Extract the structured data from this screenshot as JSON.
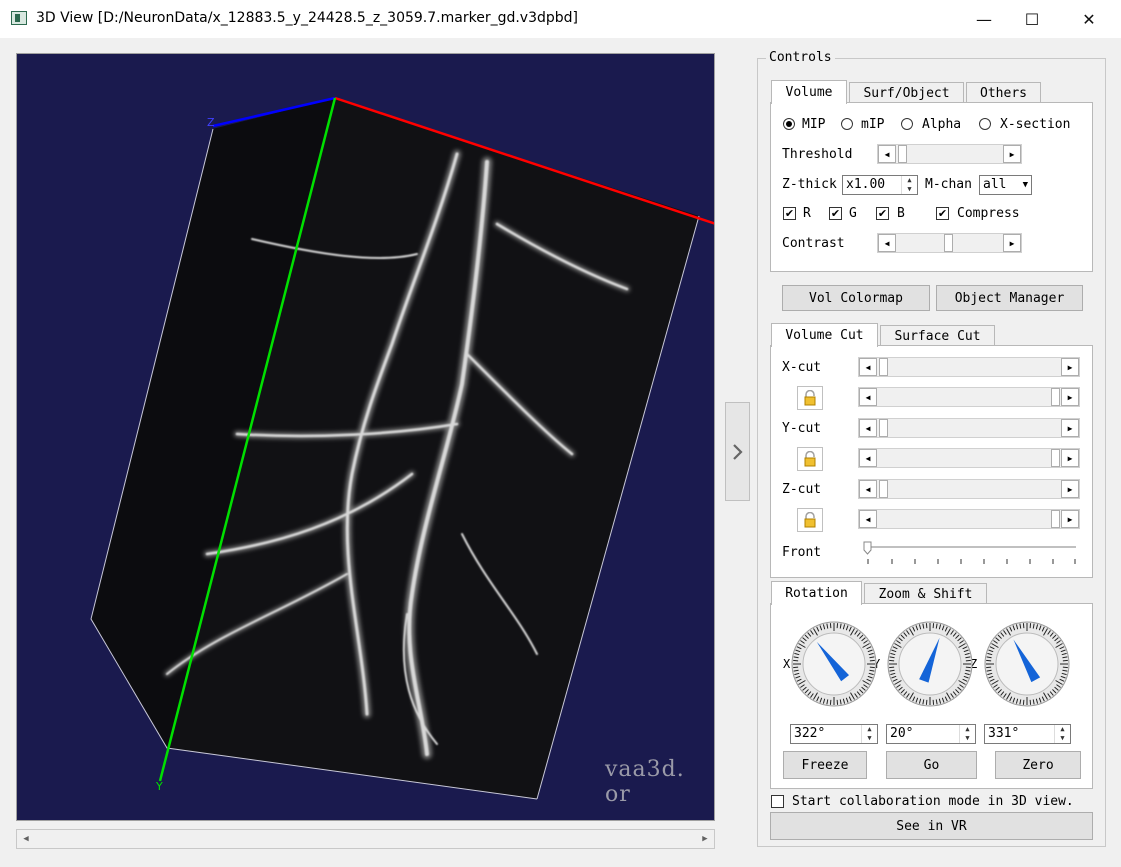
{
  "window": {
    "title": "3D View [D:/NeuronData/x_12883.5_y_24428.5_z_3059.7.marker_gd.v3dpbd]",
    "minimize": "—",
    "maximize": "☐",
    "close": "✕"
  },
  "viewport": {
    "axis_x_color": "#ff0000",
    "axis_y_color": "#00e000",
    "axis_z_color": "#0000ff",
    "axis_y_label": "Y",
    "axis_z_label": "Z",
    "watermark": "vaa3d. or",
    "background": "#1a1a4e"
  },
  "controls": {
    "legend": "Controls",
    "tabs_top": [
      "Volume",
      "Surf/Object",
      "Others"
    ],
    "render_modes": [
      "MIP",
      "mIP",
      "Alpha",
      "X-section"
    ],
    "selected_mode": "MIP",
    "threshold_label": "Threshold",
    "zthick_label": "Z-thick",
    "zthick_value": "x1.00",
    "mchan_label": "M-chan",
    "mchan_value": "all",
    "channels": [
      "R",
      "G",
      "B"
    ],
    "compress_label": "Compress",
    "contrast_label": "Contrast",
    "vol_colormap": "Vol Colormap",
    "object_manager": "Object Manager",
    "cut_tabs": [
      "Volume Cut",
      "Surface Cut"
    ],
    "xcut_label": "X-cut",
    "ycut_label": "Y-cut",
    "zcut_label": "Z-cut",
    "front_label": "Front",
    "rot_tabs": [
      "Rotation",
      "Zoom & Shift"
    ],
    "dial_labels": [
      "X",
      "Y",
      "Z"
    ],
    "rot_x": "322°",
    "rot_y": "20°",
    "rot_z": "331°",
    "rot_x_deg": 322,
    "rot_y_deg": 20,
    "rot_z_deg": 331,
    "freeze": "Freeze",
    "go": "Go",
    "zero": "Zero",
    "collab_label": "Start collaboration mode in 3D view.",
    "see_in_vr": "See in VR"
  }
}
